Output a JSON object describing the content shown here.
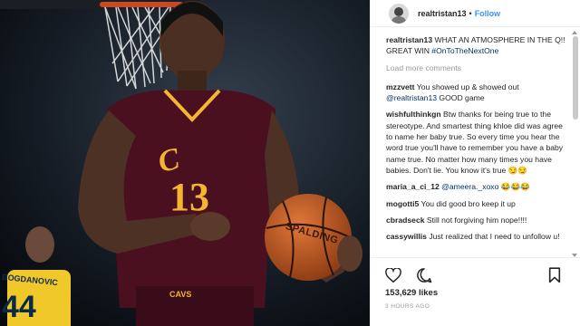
{
  "post": {
    "username": "realtristan13",
    "dot": "•",
    "follow_label": "Follow",
    "caption_user": "realtristan13",
    "caption_text": "WHAT AN ATMOSPHERE IN THE Q!! GREAT WIN",
    "caption_hashtag": "#OnToTheNextOne",
    "load_more": "Load more comments",
    "likes": "153,629 likes",
    "time": "3 HOURS AGO"
  },
  "comments": [
    {
      "user": "mzzvett",
      "pre": "You showed up & showed out",
      "mention": "@realtristan13",
      "post": "GOOD game"
    },
    {
      "user": "wishfulthinkgn",
      "pre": "Btw thanks for being true to the stereotype. And smartest thing khloe did was agree to name her baby true. So every time you hear the word true you'll have to remember you have a baby name true. No matter how many times you have babies. Don't lie. You know it's true 😏😏",
      "mention": "",
      "post": ""
    },
    {
      "user": "maria_a_ci_12",
      "pre": "",
      "mention": "@ameera._xoxo",
      "post": "😂😂😂"
    },
    {
      "user": "mogotti5",
      "pre": "You did good bro keep it up",
      "mention": "",
      "post": ""
    },
    {
      "user": "cbradseck",
      "pre": "Still not forgiving him nope!!!!",
      "mention": "",
      "post": ""
    },
    {
      "user": "cassywillis",
      "pre": "Just realized that I need to unfollow u!",
      "mention": "",
      "post": ""
    }
  ],
  "photo": {
    "logo": "C",
    "jersey_number": "13",
    "shorts_text": "CAVS",
    "ball_text": "SPALDING",
    "opponent_name": "BOGDANOVIC",
    "opponent_number": "44"
  },
  "icons": {
    "like": "heart-icon",
    "comment": "comment-icon",
    "save": "bookmark-icon"
  },
  "colors": {
    "follow": "#3897f0",
    "hashtag": "#003569",
    "muted": "#999999",
    "wine": "#4a1020",
    "gold": "#f2b632"
  }
}
